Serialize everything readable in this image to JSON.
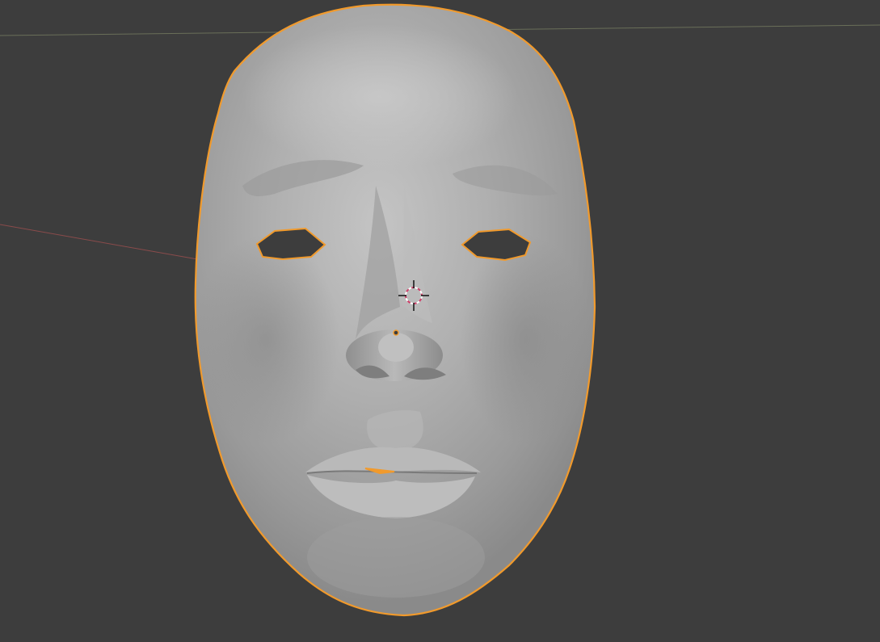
{
  "viewport": {
    "background_color": "#3d3d3d",
    "selection_outline_color": "#f19a2c",
    "face_mesh_color": "#a9a9a9",
    "x_axis_color": "#8a4b4b",
    "y_axis_color": "#6a6f59",
    "cursor_colors": [
      "#ffffff",
      "#d0406a"
    ],
    "origin_dot_color": "#f19a2c",
    "icons": [
      "3d-cursor-icon",
      "object-origin-icon"
    ]
  }
}
